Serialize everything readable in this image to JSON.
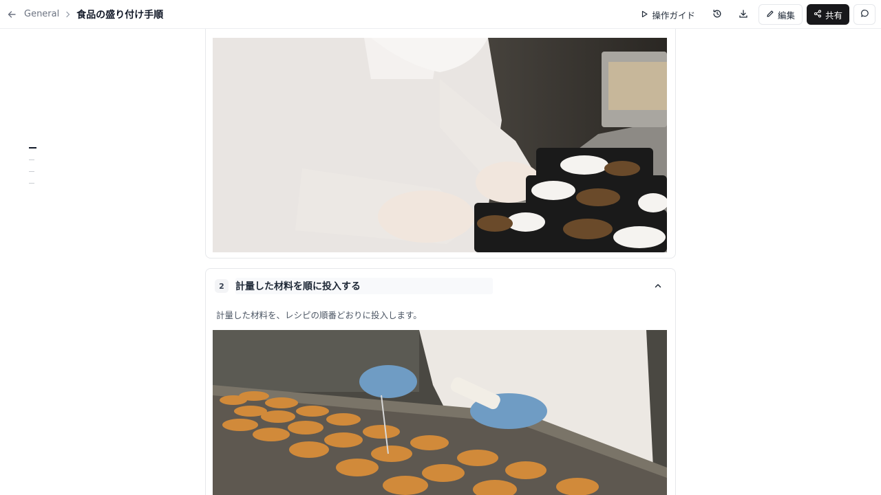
{
  "header": {
    "breadcrumb": "General",
    "title": "食品の盛り付け手順",
    "guide_label": "操作ガイド",
    "edit_label": "編集",
    "share_label": "共有"
  },
  "steps": [
    {
      "image_alt": "Worker in white gloves arranging side dishes into black bento trays"
    },
    {
      "number": "2",
      "title": "計量した材料を順に投入する",
      "description": "計量した材料を、レシピの順番どおりに投入します。",
      "image_alt": "Worker in blue gloves checking temperature of fried patties on conveyor"
    }
  ],
  "rail": {
    "count": 4,
    "active_index": 0
  },
  "colors": {
    "primary_dark": "#18181b",
    "border": "#e6e8eb"
  }
}
